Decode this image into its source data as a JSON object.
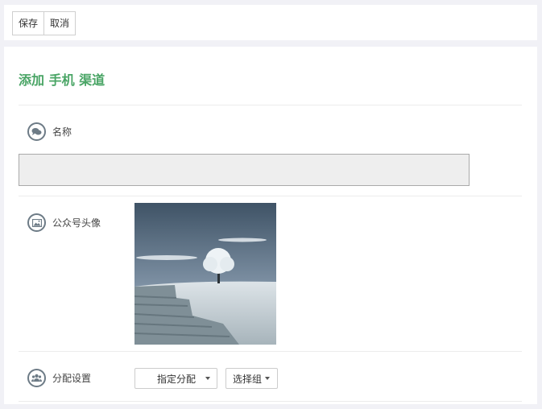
{
  "toolbar": {
    "save_label": "保存",
    "cancel_label": "取消"
  },
  "panel": {
    "title": "添加 手机 渠道",
    "name": {
      "label": "名称",
      "value": ""
    },
    "avatar": {
      "label": "公众号头像"
    },
    "assign": {
      "label": "分配设置",
      "mode_value": "指定分配",
      "group_label": "选择组"
    }
  }
}
